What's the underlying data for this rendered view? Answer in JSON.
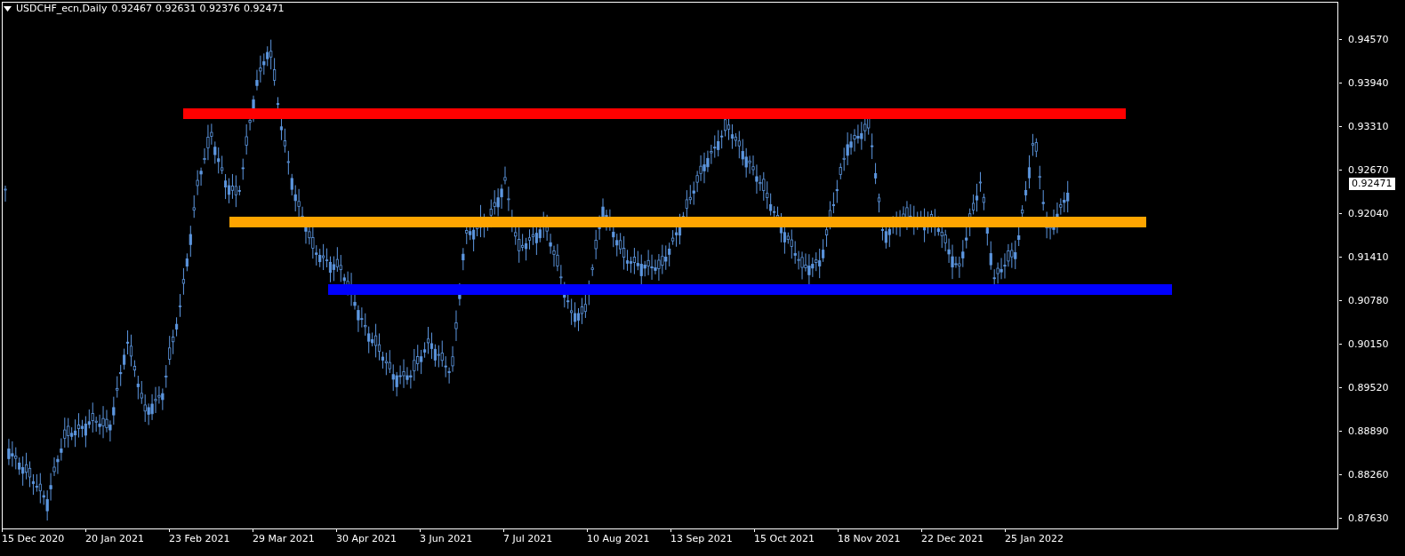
{
  "header": {
    "symbol": "USDCHF_ecn,Daily",
    "ohlc": [
      "0.92467",
      "0.92631",
      "0.92376",
      "0.92471"
    ]
  },
  "price_axis": {
    "labels": [
      "0.94570",
      "0.93940",
      "0.93310",
      "0.92670",
      "0.92040",
      "0.91410",
      "0.90780",
      "0.90150",
      "0.89520",
      "0.88890",
      "0.88260",
      "0.87630"
    ],
    "current_price": "0.92471"
  },
  "time_axis": {
    "labels": [
      "15 Dec 2020",
      "20 Jan 2021",
      "23 Feb 2021",
      "29 Mar 2021",
      "30 Apr 2021",
      "3 Jun 2021",
      "7 Jul 2021",
      "10 Aug 2021",
      "13 Sep 2021",
      "15 Oct 2021",
      "18 Nov 2021",
      "22 Dec 2021",
      "25 Jan 2022"
    ]
  },
  "levels": [
    {
      "color": "#ff0000"
    },
    {
      "color": "#ffa500"
    },
    {
      "color": "#0000ff"
    }
  ]
}
